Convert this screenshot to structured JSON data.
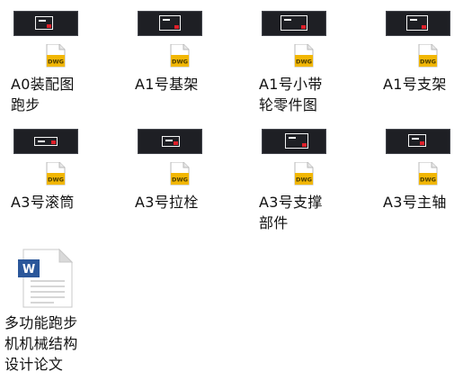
{
  "files": [
    {
      "name": "A0装配图\n跑步",
      "type": "dwg"
    },
    {
      "name": "A1号基架",
      "type": "dwg"
    },
    {
      "name": "A1号小带\n轮零件图",
      "type": "dwg"
    },
    {
      "name": "A1号支架",
      "type": "dwg"
    },
    {
      "name": "A3号滚筒",
      "type": "dwg"
    },
    {
      "name": "A3号拉栓",
      "type": "dwg"
    },
    {
      "name": "A3号支撑\n部件",
      "type": "dwg"
    },
    {
      "name": "A3号主轴",
      "type": "dwg"
    },
    {
      "name": "多功能跑步\n机机械结构\n设计论文",
      "type": "docx"
    }
  ],
  "badges": {
    "dwg_text": "DWG",
    "word_letter": "W"
  },
  "colors": {
    "thumb_bg": "#1e1f24",
    "dwg_gold": "#f2b705",
    "word_blue": "#2b579a"
  }
}
